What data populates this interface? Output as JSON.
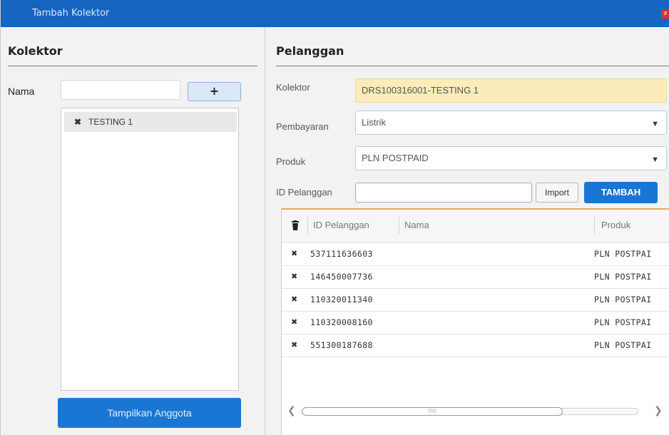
{
  "window": {
    "title": "Tambah Kolektor",
    "close_label": "x"
  },
  "kolektor": {
    "heading": "Kolektor",
    "nama_label": "Nama",
    "nama_value": "",
    "add_label": "+",
    "members": [
      {
        "name": "TESTING 1"
      }
    ],
    "show_members_label": "Tampilkan Anggota"
  },
  "pelanggan": {
    "heading": "Pelanggan",
    "kolektor_label": "Kolektor",
    "kolektor_value": "DRS100316001-TESTING 1",
    "pembayaran_label": "Pembayaran",
    "pembayaran_value": "Listrik",
    "produk_label": "Produk",
    "produk_value": "PLN POSTPAID",
    "id_label": "ID Pelanggan",
    "id_value": "",
    "import_label": "Import",
    "tambah_label": "TAMBAH",
    "columns": [
      "ID Pelanggan",
      "Nama",
      "Produk"
    ],
    "rows": [
      {
        "id": "537111636603",
        "nama": "",
        "produk": "PLN POSTPAI"
      },
      {
        "id": "146450007736",
        "nama": "",
        "produk": "PLN POSTPAI"
      },
      {
        "id": "110320011340",
        "nama": "",
        "produk": "PLN POSTPAI"
      },
      {
        "id": "110320008160",
        "nama": "",
        "produk": "PLN POSTPAI"
      },
      {
        "id": "551300187688",
        "nama": "",
        "produk": "PLN POSTPAI"
      }
    ]
  },
  "colors": {
    "titlebar": "#1565c0",
    "button_blue": "#1976d2",
    "readonly_yellow": "#fbecb9",
    "grid_accent": "#f2a93b"
  },
  "icons": {
    "remove": "close-icon",
    "delete_all": "trash-icon",
    "dropdown": "chevron-down-icon"
  }
}
